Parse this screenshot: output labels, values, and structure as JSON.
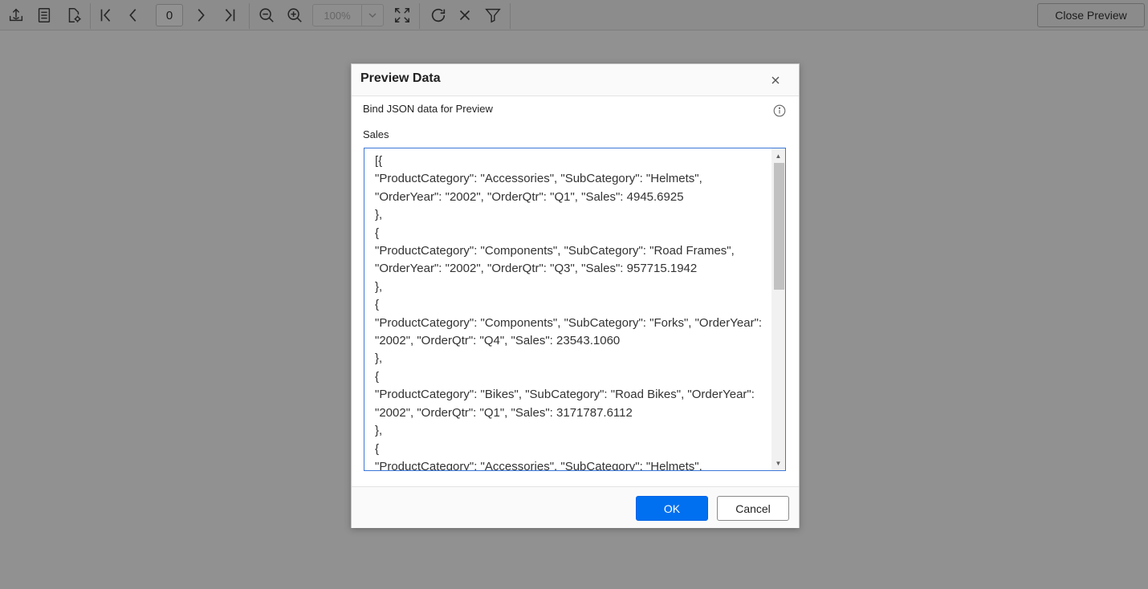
{
  "toolbar": {
    "page_number": "0",
    "zoom_value": "100%",
    "close_preview_label": "Close Preview",
    "icons": [
      "export-icon",
      "document-icon",
      "page-setup-icon",
      "first-page-icon",
      "previous-page-icon",
      "next-page-icon",
      "last-page-icon",
      "zoom-out-icon",
      "zoom-in-icon",
      "fit-page-icon",
      "refresh-icon",
      "stop-icon",
      "filter-icon"
    ]
  },
  "dialog": {
    "title": "Preview Data",
    "bind_label": "Bind JSON data for Preview",
    "dataset_label": "Sales",
    "json_text": "[{\n\"ProductCategory\": \"Accessories\", \"SubCategory\": \"Helmets\", \"OrderYear\": \"2002\", \"OrderQtr\": \"Q1\", \"Sales\": 4945.6925\n},\n{\n\"ProductCategory\": \"Components\", \"SubCategory\": \"Road Frames\", \"OrderYear\": \"2002\", \"OrderQtr\": \"Q3\", \"Sales\": 957715.1942\n},\n{\n\"ProductCategory\": \"Components\", \"SubCategory\": \"Forks\", \"OrderYear\": \"2002\", \"OrderQtr\": \"Q4\", \"Sales\": 23543.1060\n},\n{\n\"ProductCategory\": \"Bikes\", \"SubCategory\": \"Road Bikes\", \"OrderYear\": \"2002\", \"OrderQtr\": \"Q1\", \"Sales\": 3171787.6112\n},\n{\n\"ProductCategory\": \"Accessories\", \"SubCategory\": \"Helmets\",",
    "ok_label": "OK",
    "cancel_label": "Cancel"
  },
  "colors": {
    "ok_button": "#0070f0",
    "textarea_focus_border": "#3c78d8",
    "overlay": "#000000"
  }
}
